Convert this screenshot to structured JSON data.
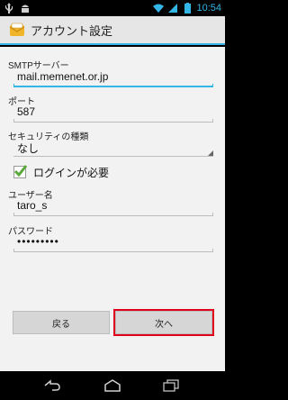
{
  "status_bar": {
    "time": "10:54",
    "icons": [
      "usb-icon",
      "android-debug-icon",
      "wifi-icon",
      "signal-icon",
      "battery-icon"
    ]
  },
  "action_bar": {
    "title": "アカウント設定",
    "icon": "mail-envelope-icon"
  },
  "form": {
    "smtp_server": {
      "label": "SMTPサーバー",
      "value": "mail.memenet.or.jp"
    },
    "port": {
      "label": "ポート",
      "value": "587"
    },
    "security_type": {
      "label": "セキュリティの種類",
      "value": "なし"
    },
    "require_login": {
      "label": "ログインが必要",
      "checked": true
    },
    "username": {
      "label": "ユーザー名",
      "value": "taro_s"
    },
    "password": {
      "label": "パスワード",
      "value": "•••••••••"
    }
  },
  "buttons": {
    "back_label": "戻る",
    "next_label": "次へ"
  },
  "colors": {
    "accent": "#33b5e5",
    "highlight": "#e0001b",
    "content_bg": "#f2f2f2"
  }
}
